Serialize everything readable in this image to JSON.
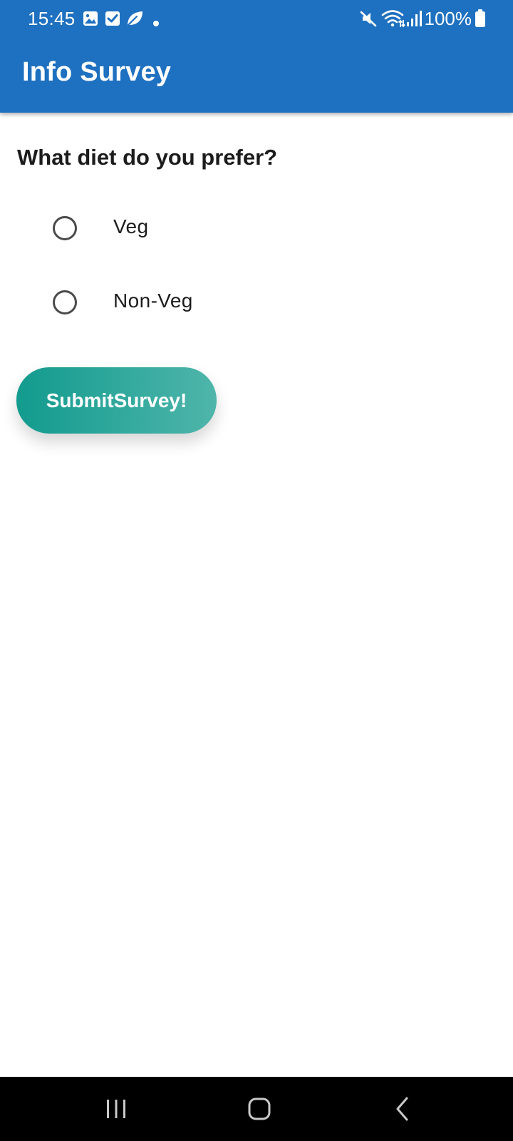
{
  "status_bar": {
    "time": "15:45",
    "notification_icons": [
      "image-icon",
      "checkbox-icon",
      "leaf-icon",
      "dot-icon"
    ],
    "system_icons": [
      "mute-icon",
      "wifi-icon",
      "signal-icon",
      "battery-icon"
    ],
    "battery_percent": "100%"
  },
  "app_bar": {
    "title": "Info Survey",
    "color": "#1e70c0"
  },
  "survey": {
    "question": "What diet do you prefer?",
    "options": [
      {
        "label": "Veg",
        "selected": false
      },
      {
        "label": "Non-Veg",
        "selected": false
      }
    ],
    "submit_label": "SubmitSurvey!",
    "submit_gradient": [
      "#129b8e",
      "#4fb5aa"
    ]
  },
  "nav_bar": {
    "buttons": [
      "recents-icon",
      "home-icon",
      "back-icon"
    ]
  }
}
